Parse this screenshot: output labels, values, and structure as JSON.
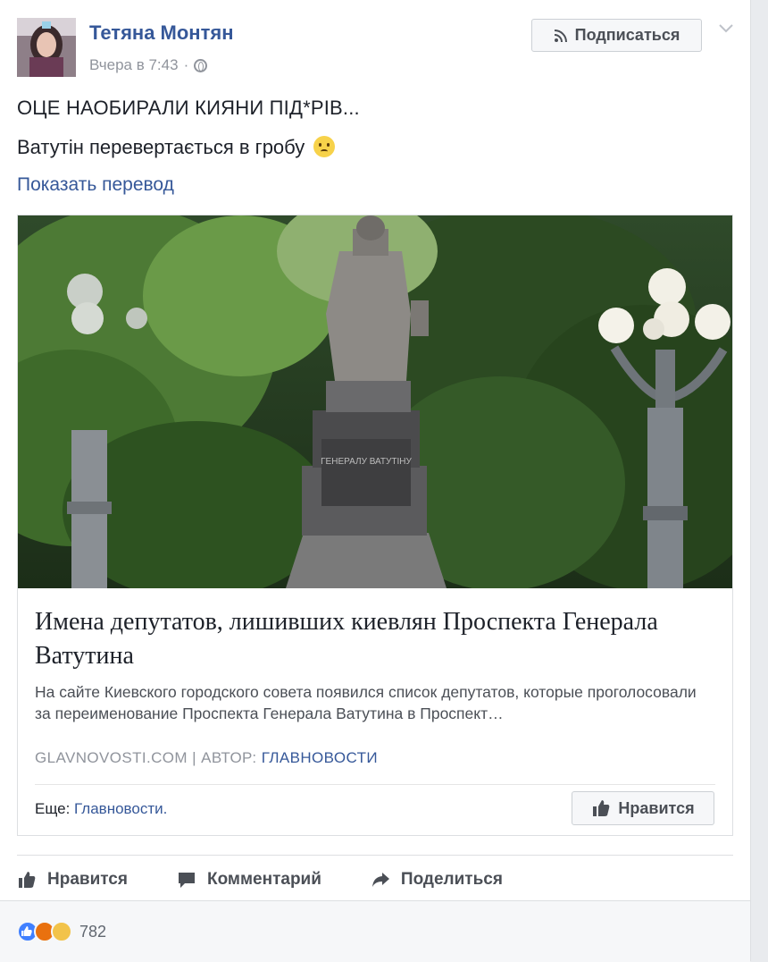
{
  "post": {
    "author": "Тетяна Монтян",
    "timestamp": "Вчера в 7:43",
    "meta_separator": "·",
    "privacy_icon": "globe-icon",
    "subscribe_label": "Подписаться",
    "text_line1": "ОЦЕ НАОБИРАЛИ КИЯНИ ПІД*РІВ...",
    "text_line2": "Ватутін перевертається в гробу",
    "emoji_icon": "worried-face-emoji",
    "translate_link": "Показать перевод"
  },
  "card": {
    "monument_inscription": "ГЕНЕРАЛУ ВАТУТІНУ",
    "title": "Имена депутатов, лишивших киевлян Проспекта Генерала Ватутина",
    "description": "На сайте Киевского городского совета появился список депутатов, которые проголосовали за переименование Проспекта Генерала Ватутина в Проспект…",
    "source_domain": "GLAVNOVOSTI.COM",
    "source_separator": "|",
    "source_author_label": "АВТОР:",
    "source_author": "ГЛАВНОВОСТИ",
    "more_label": "Еще:",
    "more_link": "Главновости.",
    "page_like_label": "Нравится"
  },
  "actions": {
    "like": "Нравится",
    "comment": "Комментарий",
    "share": "Поделиться"
  },
  "reactions": {
    "types": [
      "like",
      "angry",
      "sad"
    ],
    "count": "782"
  },
  "colors": {
    "link": "#365899",
    "secondary_text": "#90949c",
    "background": "#e9ebee",
    "like_blue": "#4080ff"
  }
}
